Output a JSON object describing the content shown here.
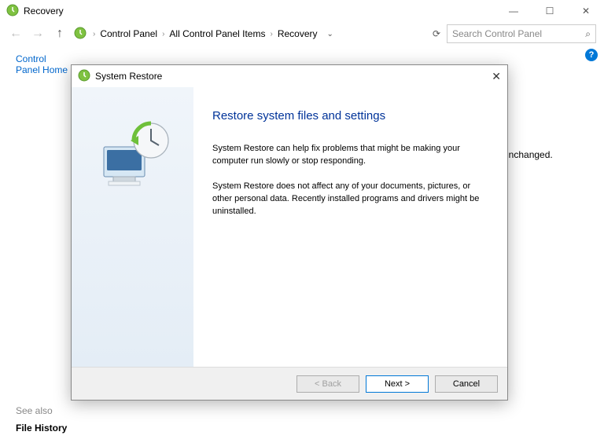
{
  "window": {
    "title": "Recovery",
    "controls": {
      "min": "—",
      "max": "☐",
      "close": "✕"
    }
  },
  "nav": {
    "back": "←",
    "forward": "→",
    "up": "↑",
    "crumbs": [
      "Control Panel",
      "All Control Panel Items",
      "Recovery"
    ],
    "sep": "›",
    "dropdown": "⌄",
    "refresh": "⟳",
    "search_placeholder": "Search Control Panel",
    "search_icon": "🔍"
  },
  "sidebar": {
    "home": "Control Panel Home",
    "see_also_label": "See also",
    "file_history": "File History"
  },
  "help_icon": "?",
  "bg_text": "ic unchanged.",
  "dialog": {
    "title": "System Restore",
    "close": "✕",
    "heading": "Restore system files and settings",
    "p1": "System Restore can help fix problems that might be making your computer run slowly or stop responding.",
    "p2": "System Restore does not affect any of your documents, pictures, or other personal data. Recently installed programs and drivers might be uninstalled.",
    "buttons": {
      "back": "< Back",
      "next": "Next >",
      "cancel": "Cancel"
    }
  }
}
